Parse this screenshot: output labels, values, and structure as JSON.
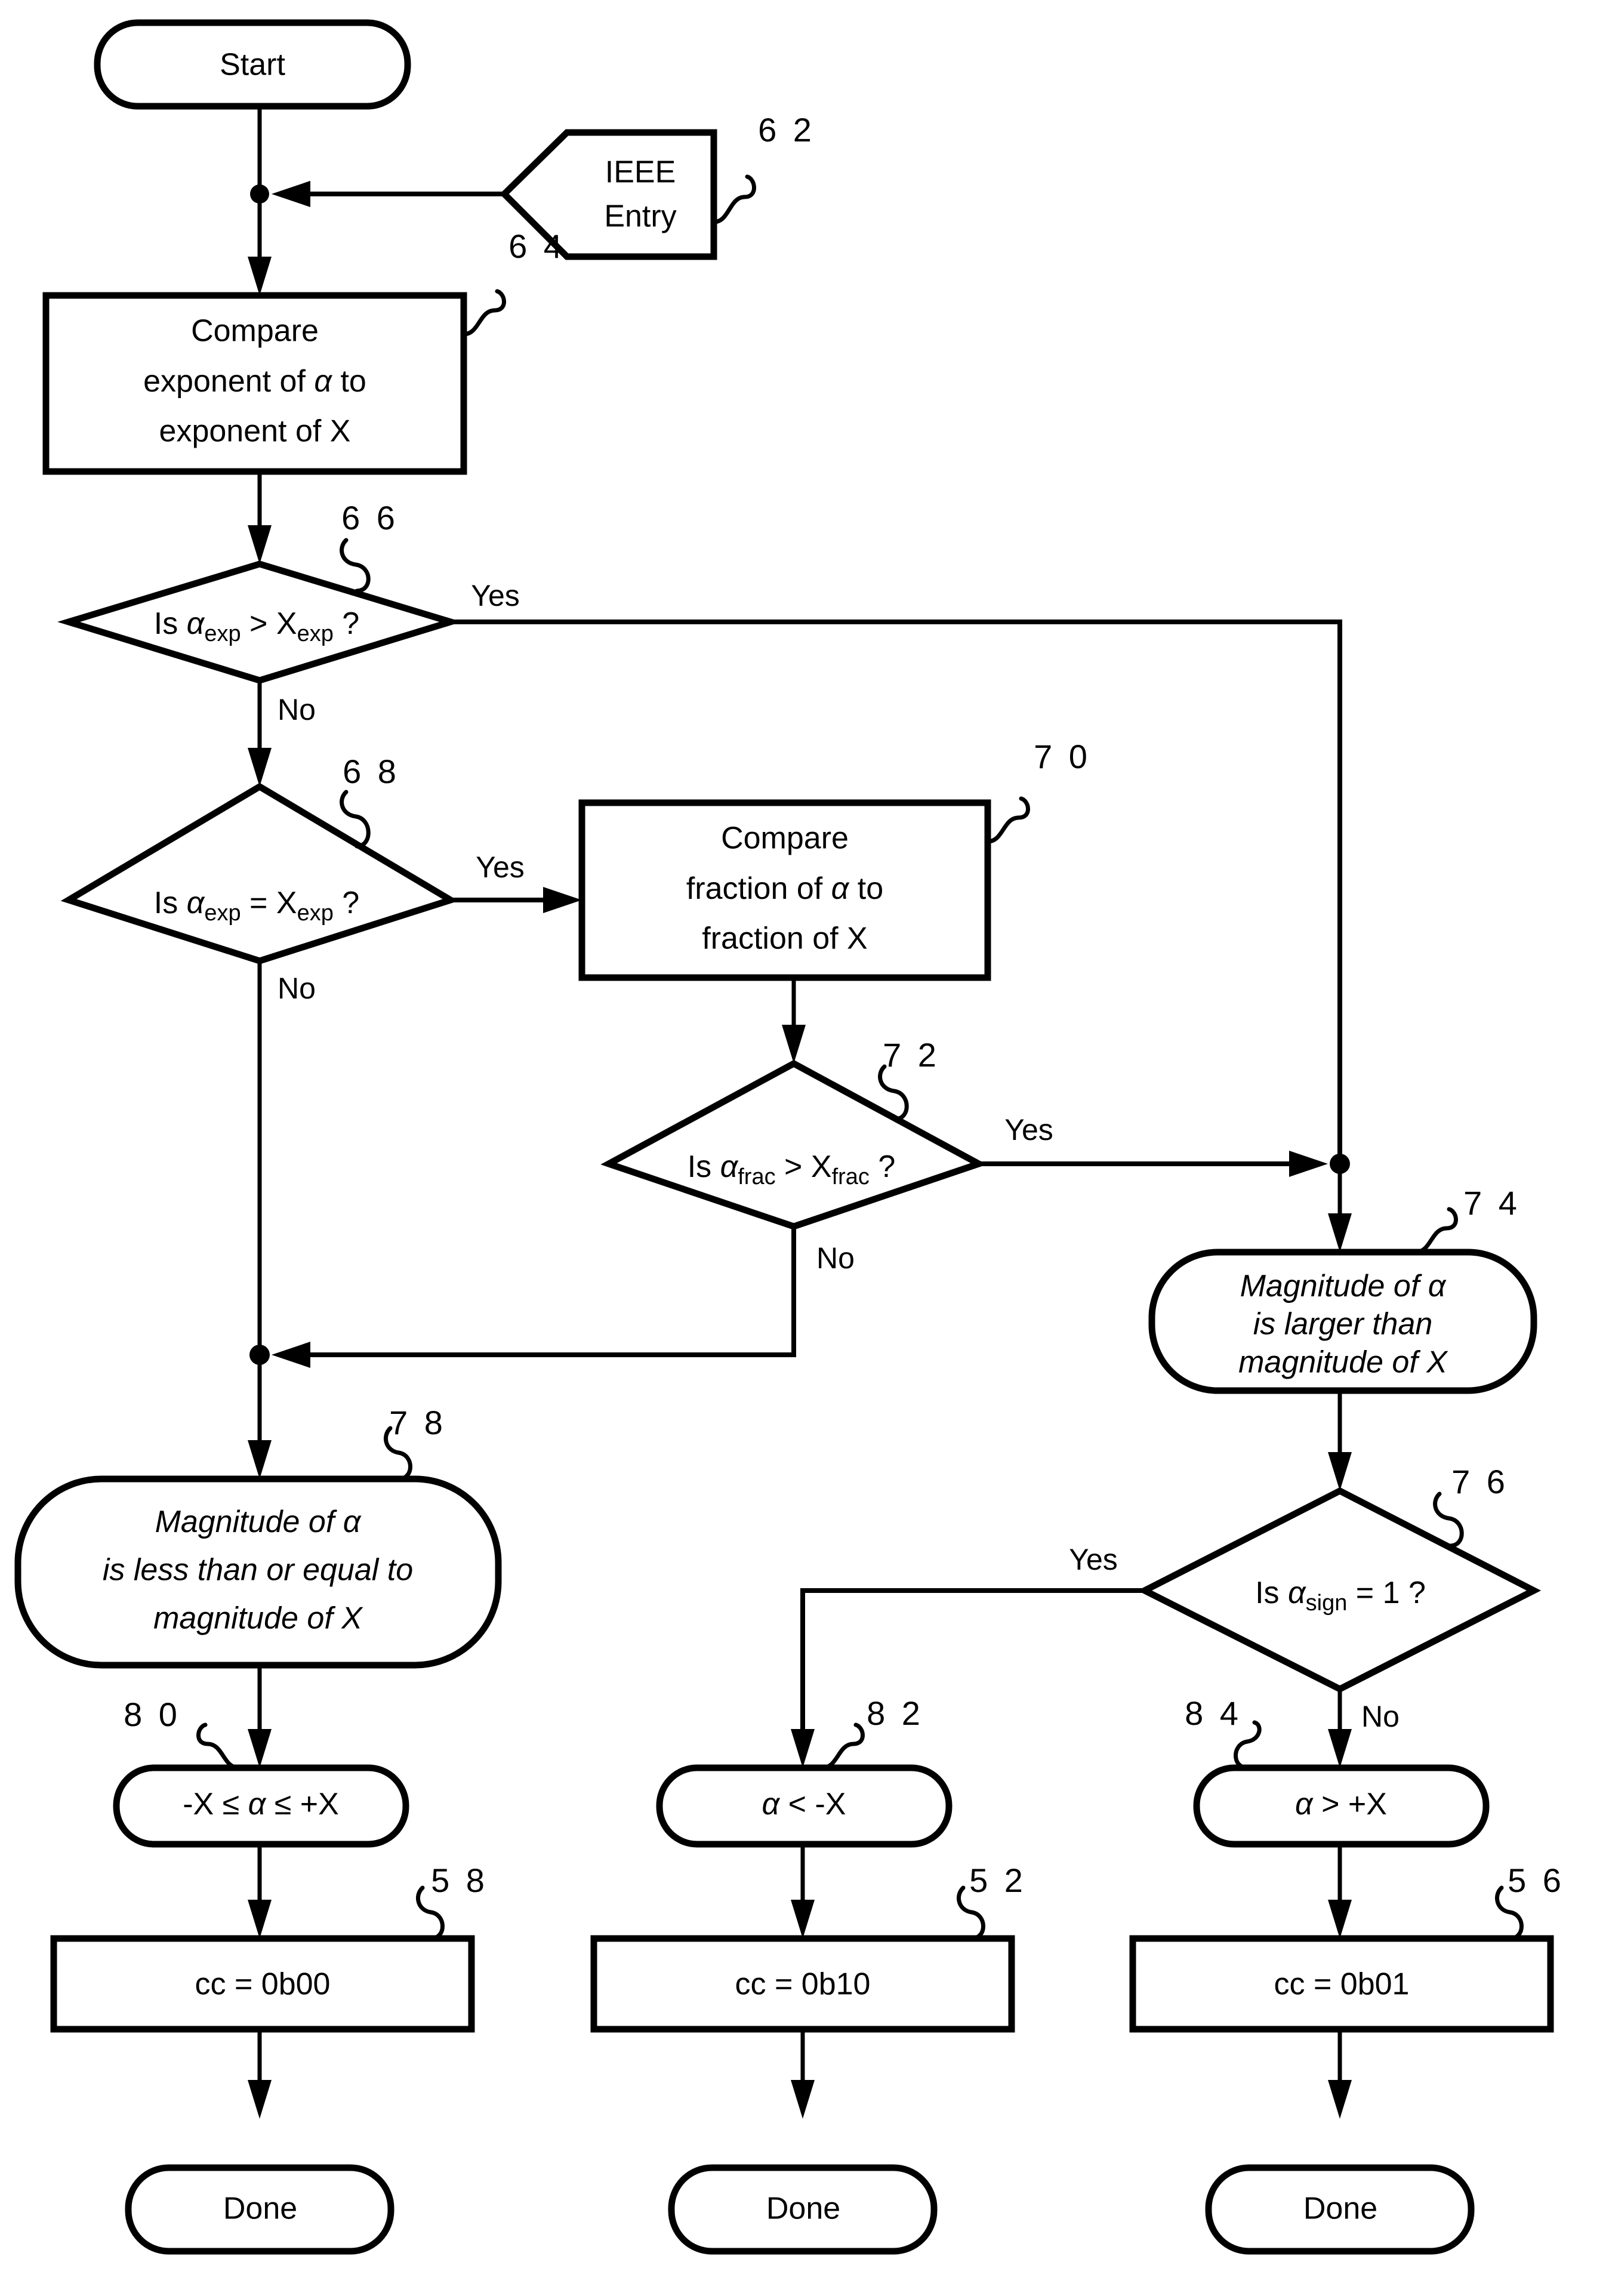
{
  "diagram": {
    "type": "flowchart",
    "title": "IEEE floating point magnitude comparison flowchart",
    "background_color": "#ffffff",
    "line_color": "#000000"
  },
  "nodes": {
    "start": {
      "id": "start",
      "shape": "terminator",
      "label": "Start",
      "ref": ""
    },
    "ieee_entry": {
      "id": "ieee_entry",
      "shape": "pentagon-entry",
      "label_line1": "IEEE",
      "label_line2": "Entry",
      "ref": "6 2"
    },
    "compare_exponent": {
      "id": "compare_exponent",
      "shape": "process",
      "ref": "6 4",
      "label_line1": "Compare",
      "label_line2_a": "exponent of ",
      "label_line2_alpha": "α",
      "label_line2_b": " to",
      "label_line3": "exponent of X"
    },
    "decision_exp_greater": {
      "id": "decision_exp_greater",
      "shape": "decision",
      "ref": "6 6",
      "label_is": "Is ",
      "label_alpha": "α",
      "label_sub1": "exp",
      "label_op": " > X",
      "label_sub2": "exp",
      "label_end": " ?",
      "yes_label": "Yes",
      "no_label": "No"
    },
    "decision_exp_equal": {
      "id": "decision_exp_equal",
      "shape": "decision",
      "ref": "6 8",
      "label_is": "Is ",
      "label_alpha": "α",
      "label_sub1": "exp",
      "label_op": " = X",
      "label_sub2": "exp",
      "label_end": " ?",
      "yes_label": "Yes",
      "no_label": "No"
    },
    "compare_fraction": {
      "id": "compare_fraction",
      "shape": "process",
      "ref": "7 0",
      "label_line1": "Compare",
      "label_line2_a": "fraction of ",
      "label_line2_alpha": "α",
      "label_line2_b": " to",
      "label_line3": "fraction of X"
    },
    "decision_frac_greater": {
      "id": "decision_frac_greater",
      "shape": "decision",
      "ref": "7 2",
      "label_is": "Is ",
      "label_alpha": "α",
      "label_sub1": "frac",
      "label_op": " > X",
      "label_sub2": "frac",
      "label_end": " ?",
      "yes_label": "Yes",
      "no_label": "No"
    },
    "magnitude_larger": {
      "id": "magnitude_larger",
      "shape": "terminator",
      "ref": "7 4",
      "label_line1_a": "Magnitude of ",
      "label_line1_alpha": "α",
      "label_line2": "is larger than",
      "label_line3": "magnitude of X"
    },
    "decision_sign": {
      "id": "decision_sign",
      "shape": "decision",
      "ref": "7 6",
      "label_is": "Is ",
      "label_alpha": "α",
      "label_sub1": "sign",
      "label_op": " = 1 ?",
      "yes_label": "Yes",
      "no_label": "No"
    },
    "magnitude_lessequal": {
      "id": "magnitude_lessequal",
      "shape": "terminator",
      "ref": "7 8",
      "label_line1_a": "Magnitude of ",
      "label_line1_alpha": "α",
      "label_line2": "is less than or equal to",
      "label_line3": "magnitude of X"
    },
    "result_within": {
      "id": "result_within",
      "shape": "terminator",
      "ref": "8 0",
      "label_a": "-X ",
      "label_le1": "≤",
      "label_alpha": " α ",
      "label_le2": "≤",
      "label_b": " +X"
    },
    "result_below": {
      "id": "result_below",
      "shape": "terminator",
      "ref": "8 2",
      "label_alpha": "α",
      "label_rest": " <  -X"
    },
    "result_above": {
      "id": "result_above",
      "shape": "terminator",
      "ref": "8 4",
      "label_alpha": "α",
      "label_rest": " >  +X"
    },
    "cc_00": {
      "id": "cc_00",
      "shape": "process",
      "ref": "5 8",
      "label": "cc = 0b00"
    },
    "cc_10": {
      "id": "cc_10",
      "shape": "process",
      "ref": "5 2",
      "label": "cc = 0b10"
    },
    "cc_01": {
      "id": "cc_01",
      "shape": "process",
      "ref": "5 6",
      "label": "cc = 0b01"
    },
    "done_left": {
      "id": "done_left",
      "shape": "terminator",
      "label": "Done"
    },
    "done_mid": {
      "id": "done_mid",
      "shape": "terminator",
      "label": "Done"
    },
    "done_right": {
      "id": "done_right",
      "shape": "terminator",
      "label": "Done"
    }
  },
  "edges": [
    {
      "from": "start",
      "to": "compare_exponent",
      "label": ""
    },
    {
      "from": "ieee_entry",
      "to": "compare_exponent",
      "label": ""
    },
    {
      "from": "compare_exponent",
      "to": "decision_exp_greater",
      "label": ""
    },
    {
      "from": "decision_exp_greater",
      "to": "magnitude_larger",
      "label": "Yes"
    },
    {
      "from": "decision_exp_greater",
      "to": "decision_exp_equal",
      "label": "No"
    },
    {
      "from": "decision_exp_equal",
      "to": "compare_fraction",
      "label": "Yes"
    },
    {
      "from": "decision_exp_equal",
      "to": "magnitude_lessequal",
      "label": "No"
    },
    {
      "from": "compare_fraction",
      "to": "decision_frac_greater",
      "label": ""
    },
    {
      "from": "decision_frac_greater",
      "to": "magnitude_larger",
      "label": "Yes"
    },
    {
      "from": "decision_frac_greater",
      "to": "magnitude_lessequal",
      "label": "No"
    },
    {
      "from": "magnitude_larger",
      "to": "decision_sign",
      "label": ""
    },
    {
      "from": "decision_sign",
      "to": "result_below",
      "label": "Yes"
    },
    {
      "from": "decision_sign",
      "to": "result_above",
      "label": "No"
    },
    {
      "from": "magnitude_lessequal",
      "to": "result_within",
      "label": ""
    },
    {
      "from": "result_within",
      "to": "cc_00",
      "label": ""
    },
    {
      "from": "result_below",
      "to": "cc_10",
      "label": ""
    },
    {
      "from": "result_above",
      "to": "cc_01",
      "label": ""
    },
    {
      "from": "cc_00",
      "to": "done_left",
      "label": ""
    },
    {
      "from": "cc_10",
      "to": "done_mid",
      "label": ""
    },
    {
      "from": "cc_01",
      "to": "done_right",
      "label": ""
    }
  ],
  "branch_labels": {
    "yes_66": "Yes",
    "no_66": "No",
    "yes_68": "Yes",
    "no_68": "No",
    "yes_72": "Yes",
    "no_72": "No",
    "yes_76": "Yes",
    "no_76": "No"
  }
}
